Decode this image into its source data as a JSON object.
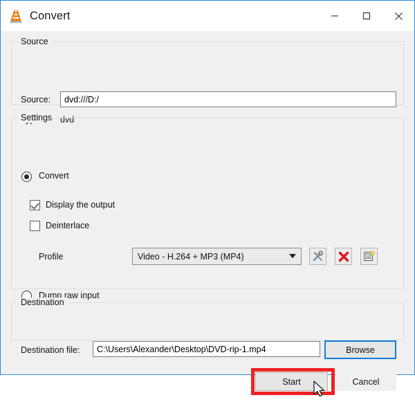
{
  "window": {
    "title": "Convert",
    "icon": "vlc-cone-icon",
    "accent_border": "#2a8ad4",
    "background": "#f0f0f0",
    "controls": {
      "minimize": "minimize-icon",
      "maximize": "maximize-icon",
      "close": "close-icon"
    }
  },
  "source_group": {
    "title": "Source",
    "source_label": "Source:",
    "source_value": "dvd:///D:/",
    "source_placeholder": "",
    "type_label": "Type:",
    "type_value": "dvd"
  },
  "settings_group": {
    "title": "Settings",
    "convert_radio": {
      "label": "Convert",
      "selected": true
    },
    "display_output_checkbox": {
      "label": "Display the output",
      "checked": true
    },
    "deinterlace_checkbox": {
      "label": "Deinterlace",
      "checked": false
    },
    "profile_label": "Profile",
    "profile_selected": "Video - H.264 + MP3 (MP4)",
    "profile_options": [
      "Video - H.264 + MP3 (MP4)"
    ],
    "profile_buttons": {
      "edit": "wrench-tools-icon",
      "delete": "red-x-icon",
      "create": "new-profile-icon"
    },
    "dump_raw_radio": {
      "label": "Dump raw input",
      "selected": false
    }
  },
  "destination_group": {
    "title": "Destination",
    "file_label": "Destination file:",
    "file_value": "C:\\Users\\Alexander\\Desktop\\DVD-rip-1.mp4",
    "browse_label": "Browse"
  },
  "footer": {
    "start_label": "Start",
    "cancel_label": "Cancel"
  },
  "annotation": {
    "highlight_target": "start-button",
    "highlight_color": "#ee2222"
  }
}
